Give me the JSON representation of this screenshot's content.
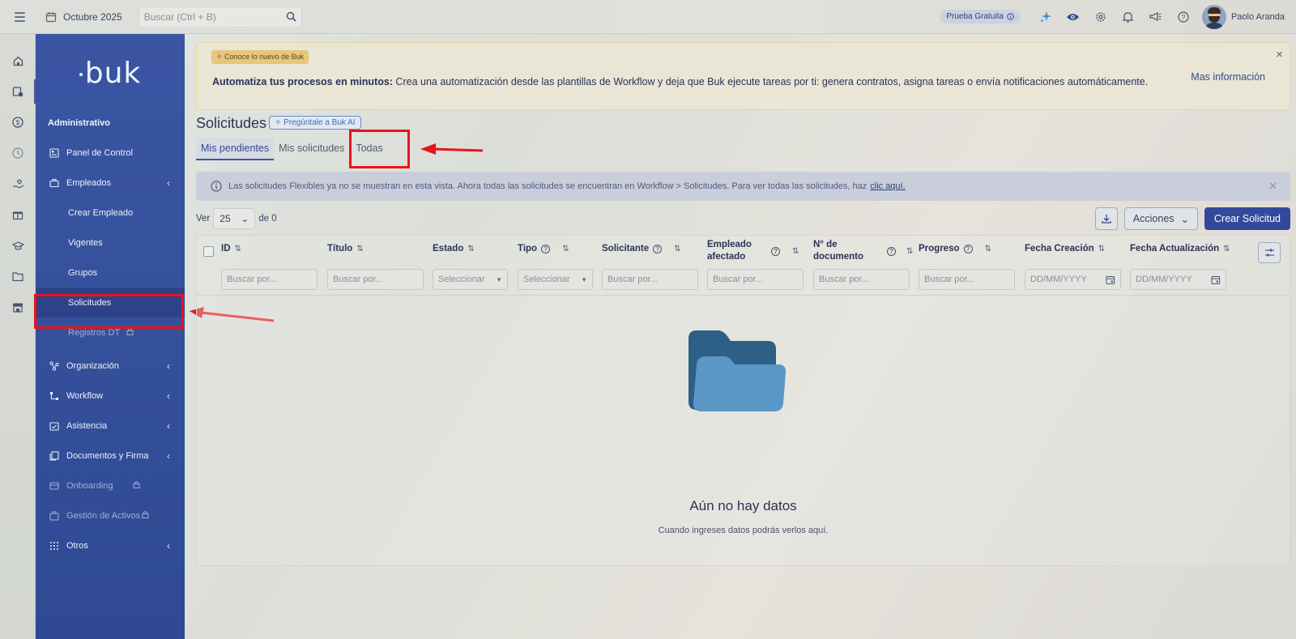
{
  "topbar": {
    "date_label": "Octubre 2025",
    "search_placeholder": "Buscar (Ctrl + B)",
    "trial_label": "Prueba Gratuita",
    "user_name": "Paolo Aranda"
  },
  "sidebar": {
    "logo": "buk",
    "section_title": "Administrativo",
    "items": [
      {
        "label": "Panel de Control"
      },
      {
        "label": "Empleados"
      },
      {
        "label": "Crear Empleado"
      },
      {
        "label": "Vigentes"
      },
      {
        "label": "Grupos"
      },
      {
        "label": "Solicitudes"
      },
      {
        "label": "Registros DT"
      },
      {
        "label": "Organización"
      },
      {
        "label": "Workflow"
      },
      {
        "label": "Asistencia"
      },
      {
        "label": "Documentos y Firma"
      },
      {
        "label": "Onboarding"
      },
      {
        "label": "Gestión de Activos"
      },
      {
        "label": "Otros"
      }
    ]
  },
  "banner": {
    "tag": "Conoce lo nuevo de Buk",
    "bold": "Automatiza tus procesos en minutos:",
    "text": " Crea una automatización desde las plantillas de Workflow y deja que Buk ejecute tareas por ti: genera contratos, asigna tareas o envía notificaciones automáticamente.",
    "more": "Mas información",
    "close": "×"
  },
  "page": {
    "title": "Solicitudes",
    "ai_badge": "Pregúntale a Buk AI",
    "tabs": [
      "Mis pendientes",
      "Mis solicitudes",
      "Todas"
    ]
  },
  "info": {
    "text": "Las solicitudes Flexibles ya no se muestran en esta vista. Ahora todas las solicitudes se encuentran en Workflow > Solicitudes. Para ver todas las solicitudes, haz",
    "link": "clic aquí."
  },
  "toolbar": {
    "ver": "Ver",
    "page_size": "25",
    "de": "de 0",
    "acciones": "Acciones",
    "crear": "Crear Solicitud"
  },
  "table": {
    "columns": [
      "ID",
      "Título",
      "Estado",
      "Tipo",
      "Solicitante",
      "Empleado afectado",
      "N° de documento",
      "Progreso",
      "Fecha Creación",
      "Fecha Actualización"
    ],
    "filter_text": "Buscar por...",
    "filter_select": "Seleccionar",
    "filter_date": "DD/MM/YYYY"
  },
  "empty": {
    "title": "Aún no hay datos",
    "subtitle": "Cuando ingreses datos podrás verlos aquí."
  },
  "colors": {
    "sidebar": "#3a55a3",
    "primary_button": "#34499a",
    "annotation_red": "#e8141c",
    "folder_dark": "#2e5f86",
    "folder_light": "#5b97c6"
  }
}
